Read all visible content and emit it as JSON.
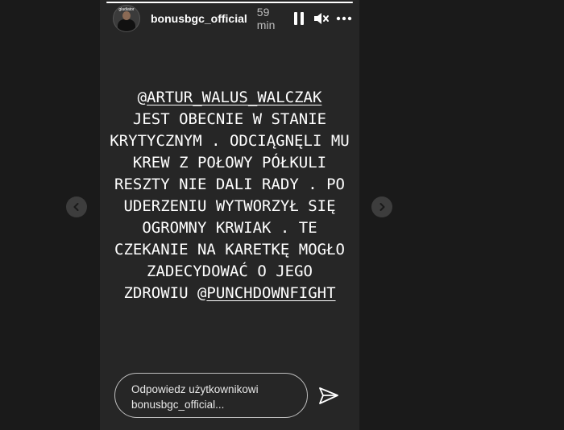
{
  "story": {
    "progress": 1.0,
    "header": {
      "avatar_caption": "gladiator",
      "username": "bonusbgc_official",
      "time": "59 min"
    },
    "icons": {
      "pause": "pause-icon",
      "mute": "volume-muted-icon",
      "more": "more-options-icon",
      "send": "send-icon",
      "prev": "chevron-left-icon",
      "next": "chevron-right-icon"
    },
    "text_lines": [
      {
        "prefix": "@",
        "mention": "ARTUR_WALUS_WALCZAK",
        "suffix": ""
      },
      {
        "prefix": "JEST OBECNIE W STANIE",
        "mention": "",
        "suffix": ""
      },
      {
        "prefix": "KRYTYCZNYM . ODCIĄGNĘLI MU",
        "mention": "",
        "suffix": ""
      },
      {
        "prefix": "KREW Z POŁOWY PÓŁKULI",
        "mention": "",
        "suffix": ""
      },
      {
        "prefix": "RESZTY NIE DALI RADY . PO",
        "mention": "",
        "suffix": ""
      },
      {
        "prefix": "UDERZENIU WYTWORZYŁ SIĘ",
        "mention": "",
        "suffix": ""
      },
      {
        "prefix": "OGROMNY KRWIAK . TE",
        "mention": "",
        "suffix": ""
      },
      {
        "prefix": "CZEKANIE NA KARETKĘ MOGŁO",
        "mention": "",
        "suffix": ""
      },
      {
        "prefix": "ZADECYDOWAĆ O JEGO",
        "mention": "",
        "suffix": ""
      },
      {
        "prefix": "ZDROWIU @",
        "mention": "PUNCHDOWNFIGHT",
        "suffix": ""
      }
    ],
    "reply": {
      "placeholder_line1": "Odpowiedz użytkownikowi",
      "placeholder_line2": "bonusbgc_official..."
    }
  },
  "colors": {
    "background": "#1a1a1a",
    "story_bg": "#262626",
    "text": "#ffffff",
    "muted": "#bdbdbd"
  }
}
